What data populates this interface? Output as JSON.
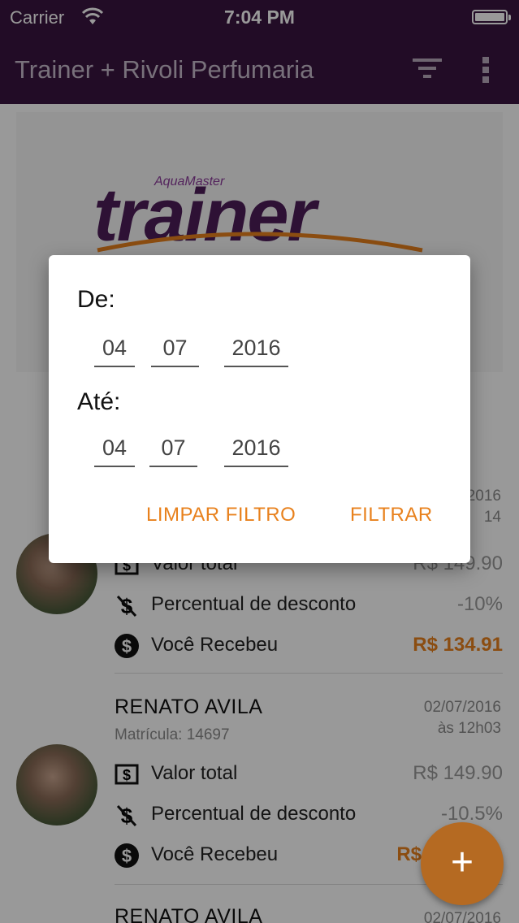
{
  "status_bar": {
    "carrier": "Carrier",
    "time": "7:04 PM"
  },
  "app_bar": {
    "title": "Trainer + Rivoli Perfumaria",
    "actions": [
      "filter-icon",
      "more-vert-icon"
    ]
  },
  "banner": {
    "brand_small": "AquaMaster",
    "brand_large": "trainer"
  },
  "cards": [
    {
      "date": "2016",
      "time": "14",
      "rows": [
        {
          "icon": "dollar-box-icon",
          "label": "Valor total",
          "value": "R$ 149.90"
        },
        {
          "icon": "no-dollar-icon",
          "label": "Percentual de desconto",
          "value": "-10%"
        },
        {
          "icon": "dollar-circle-icon",
          "label": "Você Recebeu",
          "value": "R$ 134.91"
        }
      ]
    },
    {
      "name": "RENATO AVILA",
      "matricula": "Matrícula: 14697",
      "date": "02/07/2016",
      "time": "às 12h03",
      "rows": [
        {
          "icon": "dollar-box-icon",
          "label": "Valor total",
          "value": "R$ 149.90"
        },
        {
          "icon": "no-dollar-icon",
          "label": "Percentual de desconto",
          "value": "-10.5%"
        },
        {
          "icon": "dollar-circle-icon",
          "label": "Você Recebeu",
          "value": "R$"
        }
      ]
    },
    {
      "name": "RENATO AVILA",
      "date": "02/07/2016"
    }
  ],
  "fab": {
    "icon": "plus-icon",
    "label": "+"
  },
  "dialog": {
    "from_label": "De:",
    "from": {
      "day": "04",
      "month": "07",
      "year": "2016"
    },
    "to_label": "Até:",
    "to": {
      "day": "04",
      "month": "07",
      "year": "2016"
    },
    "clear_button": "LIMPAR FILTRO",
    "apply_button": "FILTRAR"
  },
  "colors": {
    "primary": "#3a1440",
    "accent": "#e8811d"
  }
}
